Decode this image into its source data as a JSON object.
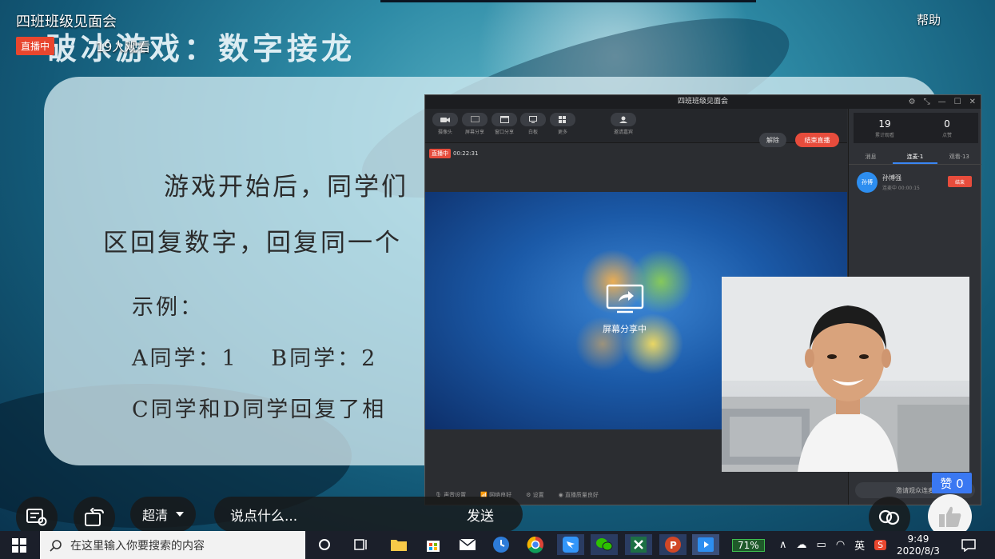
{
  "overlay": {
    "room_title": "四班班级见面会",
    "live_badge": "直播中",
    "viewers": "19人观看",
    "help": "帮助"
  },
  "slide": {
    "title": "破冰游戏：数字接龙",
    "line1": "游戏开始后，同学们",
    "line2": "区回复数字，回复同一个",
    "line3": "示例：",
    "line4": "A同学：1　 B同学：2",
    "line5": "C同学和D同学回复了相"
  },
  "stream_window": {
    "title": "四班班级见面会",
    "toolbar": [
      {
        "icon": "camera-icon",
        "label": "摄像头"
      },
      {
        "icon": "screen-share-icon",
        "label": "屏幕分享"
      },
      {
        "icon": "window-share-icon",
        "label": "窗口分享"
      },
      {
        "icon": "whiteboard-icon",
        "label": "白板"
      },
      {
        "icon": "more-icon",
        "label": "更多"
      },
      {
        "icon": "invite-guest-icon",
        "label": "邀请嘉宾"
      }
    ],
    "mute_label": "解除",
    "end_live_label": "结束直播",
    "rec_badge": "直播中",
    "timer": "00:22:31",
    "share_label": "屏幕分享中",
    "bottom_items": [
      "声音设置",
      "网络良好",
      "设置",
      "直播质量良好"
    ],
    "stats": [
      {
        "value": "19",
        "label": "累计观看"
      },
      {
        "value": "0",
        "label": "点赞"
      }
    ],
    "side_tabs": [
      "消息",
      "连麦·1",
      "观看·13"
    ],
    "active_tab": 1,
    "guest": {
      "avatar": "孙博",
      "name": "孙博强",
      "status": "连麦中 00:00:15",
      "action": "结束"
    },
    "invite_label": "邀请观众连麦"
  },
  "controls": {
    "quality": "超清",
    "comment_placeholder": "说点什么...",
    "send": "发送",
    "like_count": "赞 0"
  },
  "taskbar": {
    "search_placeholder": "在这里输入你要搜索的内容",
    "battery": "71%",
    "ime": "英",
    "time": "9:49",
    "date": "2020/8/3"
  },
  "colors": {
    "live": "#e8462e",
    "accent": "#3a78f2",
    "end": "#e74c3c"
  }
}
